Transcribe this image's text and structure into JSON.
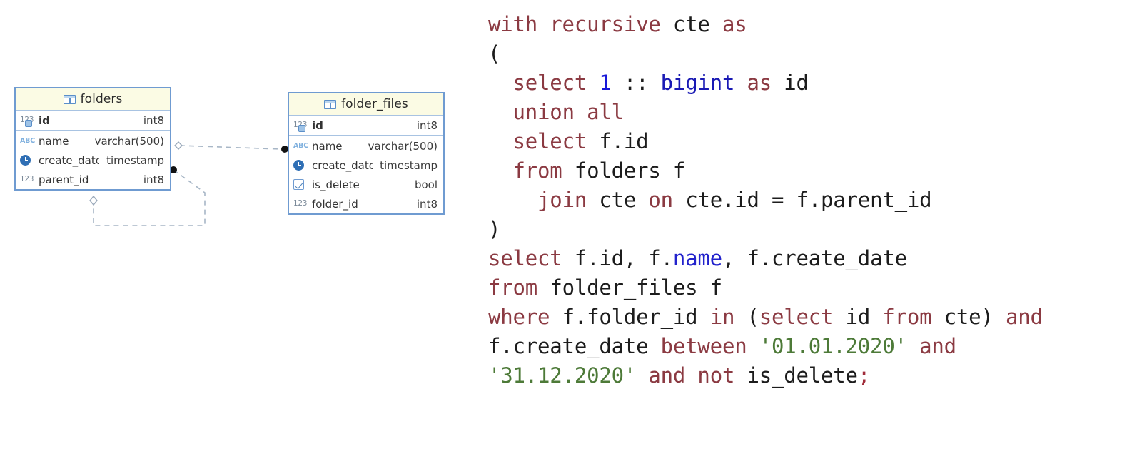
{
  "diagram": {
    "tables": [
      {
        "name": "folders",
        "icon": "table-icon",
        "pk_columns": [
          {
            "name": "id",
            "type": "int8",
            "icon": "number-key-icon"
          }
        ],
        "columns": [
          {
            "name": "name",
            "type": "varchar(500)",
            "icon": "abc-icon"
          },
          {
            "name": "create_date",
            "type": "timestamp",
            "icon": "clock-icon"
          },
          {
            "name": "parent_id",
            "type": "int8",
            "icon": "number-icon"
          }
        ]
      },
      {
        "name": "folder_files",
        "icon": "table-icon",
        "pk_columns": [
          {
            "name": "id",
            "type": "int8",
            "icon": "number-key-icon"
          }
        ],
        "columns": [
          {
            "name": "name",
            "type": "varchar(500)",
            "icon": "abc-icon"
          },
          {
            "name": "create_date",
            "type": "timestamp",
            "icon": "clock-icon"
          },
          {
            "name": "is_delete",
            "type": "bool",
            "icon": "checkbox-icon"
          },
          {
            "name": "folder_id",
            "type": "int8",
            "icon": "number-icon"
          }
        ]
      }
    ],
    "relationships": [
      {
        "from": "folders.name",
        "to": "folder_files.name",
        "style": "dashed",
        "from_marker": "diamond",
        "to_marker": "dot"
      },
      {
        "from": "folders.create_date",
        "to": "folders.parent_id",
        "style": "dashed",
        "from_marker": "dot",
        "to_marker": "diamond"
      }
    ],
    "colors": {
      "table_border": "#6f9bd1",
      "header_bg": "#fbfbe4",
      "connector": "#a7b6c6"
    }
  },
  "sql": {
    "language": "sql",
    "lines": [
      [
        {
          "t": "with recursive ",
          "c": "kw"
        },
        {
          "t": "cte ",
          "c": "pun"
        },
        {
          "t": "as",
          "c": "kw"
        }
      ],
      [
        {
          "t": "(",
          "c": "pun"
        }
      ],
      [
        {
          "t": "  ",
          "c": "pun"
        },
        {
          "t": "select ",
          "c": "kw"
        },
        {
          "t": "1",
          "c": "num"
        },
        {
          "t": " :: ",
          "c": "pun"
        },
        {
          "t": "bigint",
          "c": "typ"
        },
        {
          "t": " as ",
          "c": "kw"
        },
        {
          "t": "id",
          "c": "pun"
        }
      ],
      [
        {
          "t": "  ",
          "c": "pun"
        },
        {
          "t": "union all",
          "c": "kw"
        }
      ],
      [
        {
          "t": "  ",
          "c": "pun"
        },
        {
          "t": "select ",
          "c": "kw"
        },
        {
          "t": "f.id",
          "c": "pun"
        }
      ],
      [
        {
          "t": "  ",
          "c": "pun"
        },
        {
          "t": "from ",
          "c": "kw"
        },
        {
          "t": "folders f",
          "c": "pun"
        }
      ],
      [
        {
          "t": "    ",
          "c": "pun"
        },
        {
          "t": "join ",
          "c": "kw"
        },
        {
          "t": "cte ",
          "c": "pun"
        },
        {
          "t": "on ",
          "c": "kw"
        },
        {
          "t": "cte.id = f.parent_id",
          "c": "pun"
        }
      ],
      [
        {
          "t": ")",
          "c": "pun"
        }
      ],
      [
        {
          "t": "select ",
          "c": "kw"
        },
        {
          "t": "f.id, f.",
          "c": "pun"
        },
        {
          "t": "name",
          "c": "col"
        },
        {
          "t": ", f.create_date",
          "c": "pun"
        }
      ],
      [
        {
          "t": "from ",
          "c": "kw"
        },
        {
          "t": "folder_files f",
          "c": "pun"
        }
      ],
      [
        {
          "t": "where ",
          "c": "kw"
        },
        {
          "t": "f.folder_id ",
          "c": "pun"
        },
        {
          "t": "in ",
          "c": "kw"
        },
        {
          "t": "(",
          "c": "pun"
        },
        {
          "t": "select ",
          "c": "kw"
        },
        {
          "t": "id ",
          "c": "pun"
        },
        {
          "t": "from ",
          "c": "kw"
        },
        {
          "t": "cte) ",
          "c": "pun"
        },
        {
          "t": "and",
          "c": "kw"
        }
      ],
      [
        {
          "t": "f.create_date ",
          "c": "pun"
        },
        {
          "t": "between ",
          "c": "kw"
        },
        {
          "t": "'01.01.2020'",
          "c": "str"
        },
        {
          "t": " ",
          "c": "pun"
        },
        {
          "t": "and",
          "c": "kw"
        }
      ],
      [
        {
          "t": "'31.12.2020'",
          "c": "str"
        },
        {
          "t": " ",
          "c": "pun"
        },
        {
          "t": "and not ",
          "c": "kw"
        },
        {
          "t": "is_delete",
          "c": "pun"
        },
        {
          "t": ";",
          "c": "semi"
        }
      ]
    ],
    "colors": {
      "keyword": "#8b3a42",
      "number": "#1818d8",
      "type": "#1a1ab4",
      "column": "#2222cc",
      "string": "#4d7a38",
      "plain": "#1c1c1c"
    }
  }
}
